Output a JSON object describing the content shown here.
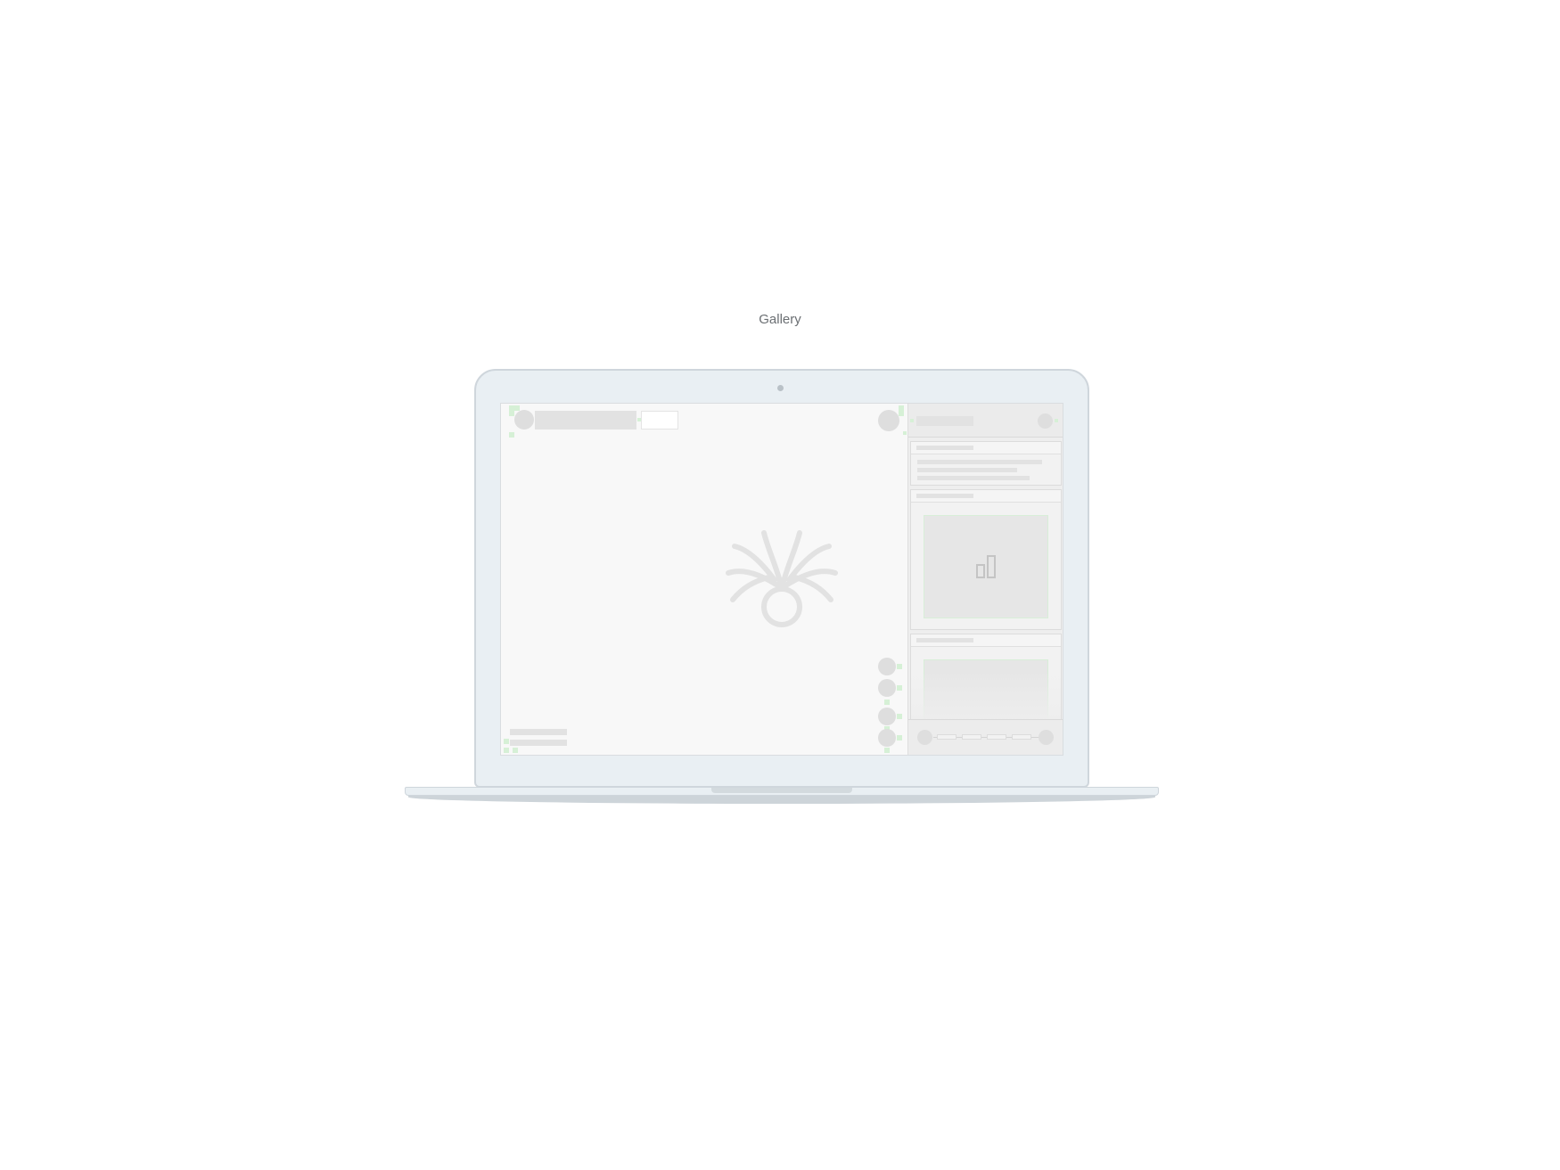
{
  "page": {
    "title": "Gallery"
  },
  "device": {
    "type": "laptop"
  },
  "colors": {
    "background": "#ffffff",
    "laptop_body": "#e9eff3",
    "laptop_border": "#cfd6dc",
    "screen_bg": "#f8f8f8",
    "skeleton": "#e2e2e2",
    "highlight": "#d6f0d6"
  },
  "icons": {
    "center_logo": "tree-roots-logo-icon",
    "chart_placeholder": "bar-chart-icon"
  }
}
